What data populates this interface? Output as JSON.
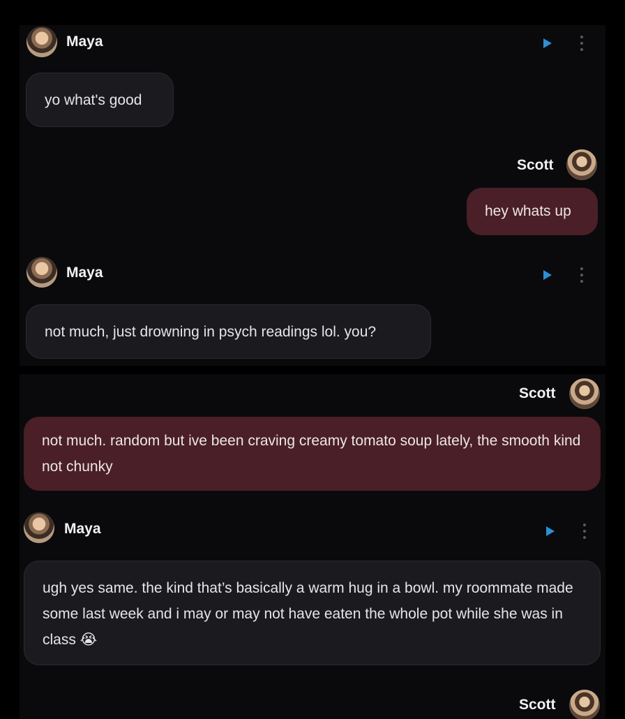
{
  "participants": {
    "ai_name": "Maya",
    "user_name": "Scott"
  },
  "colors": {
    "page_background": "#000000",
    "panel_background": "#0a0a0c",
    "ai_bubble": "#1b1b1f",
    "user_bubble": "#4a1f27",
    "play_accent": "#2d8fd6"
  },
  "icons": {
    "play": "play-icon",
    "more": "more-vertical-icon"
  },
  "messages": [
    {
      "sender": "Maya",
      "text": "yo what's good"
    },
    {
      "sender": "Scott",
      "text": "hey whats up"
    },
    {
      "sender": "Maya",
      "text": "not much, just drowning in psych readings lol. you?"
    },
    {
      "sender": "Scott",
      "text": "not much. random but ive been craving creamy tomato soup lately, the smooth kind not chunky"
    },
    {
      "sender": "Maya",
      "text": "ugh yes same. the kind that’s basically a warm hug in a bowl. my roommate made some last week and i may or may not have eaten the whole pot while she was in class 😭"
    },
    {
      "sender": "Scott",
      "text": ""
    }
  ]
}
